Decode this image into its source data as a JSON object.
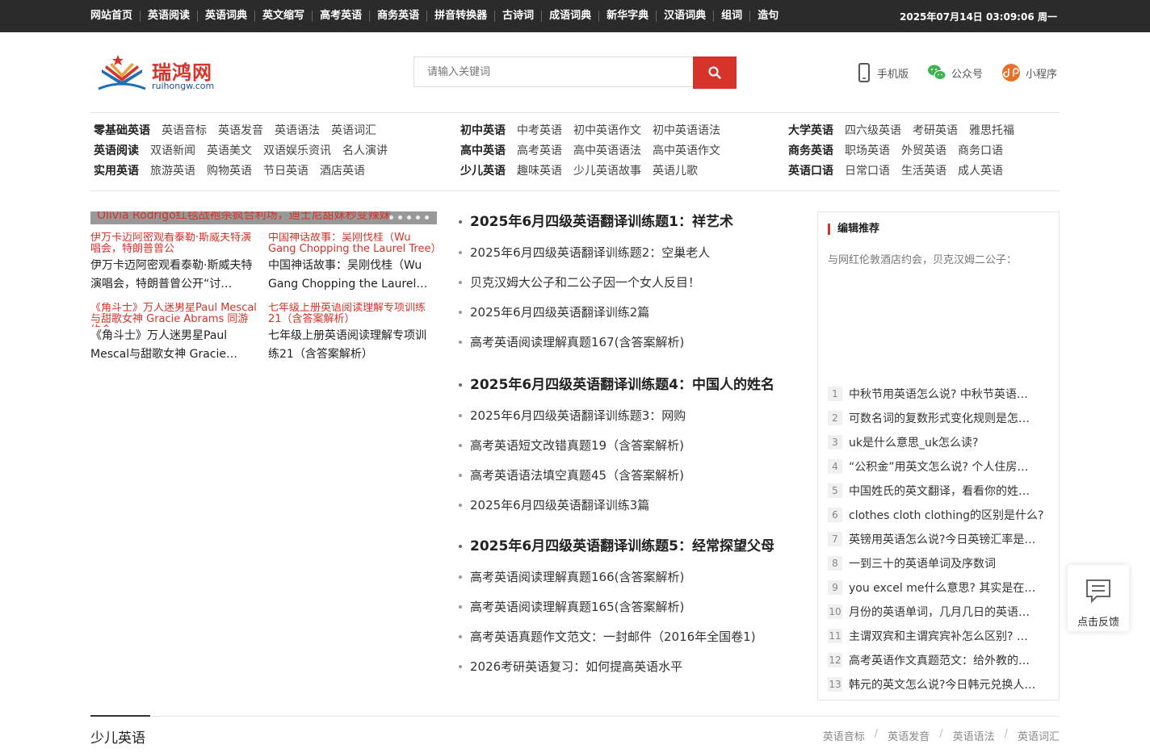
{
  "topnav": {
    "links": [
      "网站首页",
      "英语阅读",
      "英语词典",
      "英文缩写",
      "高考英语",
      "商务英语",
      "拼音转换器",
      "古诗词",
      "成语词典",
      "新华字典",
      "汉语词典",
      "组词",
      "造句"
    ],
    "date": "2025年07月14日 03:09:06",
    "weekday": "周一"
  },
  "logo": {
    "name": "瑞鸿网",
    "domain": "ruihongw.com"
  },
  "search": {
    "placeholder": "请输入关键词",
    "icon": "search-icon"
  },
  "tools": {
    "mobile": "手机版",
    "wechat": "公众号",
    "miniapp": "小程序"
  },
  "categories": [
    {
      "rows": [
        {
          "head": "零基础英语",
          "items": [
            "英语音标",
            "英语发音",
            "英语语法",
            "英语词汇"
          ]
        },
        {
          "head": "英语阅读",
          "items": [
            "双语新闻",
            "英语美文",
            "双语娱乐资讯",
            "名人演讲"
          ]
        },
        {
          "head": "实用英语",
          "items": [
            "旅游英语",
            "购物英语",
            "节日英语",
            "酒店英语"
          ]
        }
      ]
    },
    {
      "rows": [
        {
          "head": "初中英语",
          "items": [
            "中考英语",
            "初中英语作文",
            "初中英语语法"
          ]
        },
        {
          "head": "高中英语",
          "items": [
            "高考英语",
            "高中英语语法",
            "高中英语作文"
          ]
        },
        {
          "head": "少儿英语",
          "items": [
            "趣味英语",
            "少儿英语故事",
            "英语儿歌"
          ]
        }
      ]
    },
    {
      "rows": [
        {
          "head": "大学英语",
          "items": [
            "四六级英语",
            "考研英语",
            "雅思托福"
          ]
        },
        {
          "head": "商务英语",
          "items": [
            "职场英语",
            "外贸英语",
            "商务口语"
          ]
        },
        {
          "head": "英语口语",
          "items": [
            "日常口语",
            "生活英语",
            "成人英语"
          ]
        }
      ]
    }
  ],
  "slider": {
    "caption": "Olivia Rodrigo红毯战袍杀疯合利场，迪士尼甜妹秒变辣妹"
  },
  "thumbs": [
    {
      "alt": "伊万卡迈阿密观看泰勒·斯威夫特演唱会，特朗普曾公",
      "title": "伊万卡迈阿密观看泰勒·斯威夫特演唱会，特朗普曾公开“讨…"
    },
    {
      "alt": "中国神话故事：吴刚伐桂（Wu Gang Chopping the Laurel Tree）",
      "title": "中国神话故事：吴刚伐桂（Wu Gang Chopping the Laurel…"
    },
    {
      "alt": "《角斗士》万人迷男星Paul Mescal与甜歌女神 Gracie Abrams 同游约会",
      "title": "《角斗士》万人迷男星Paul Mescal与甜歌女神 Gracie…"
    },
    {
      "alt": "七年级上册英语阅读理解专项训练21（含答案解析）",
      "title": "七年级上册英语阅读理解专项训练21（含答案解析）"
    }
  ],
  "news": [
    {
      "head": "2025年6月四级英语翻译训练题1：祥艺术",
      "items": [
        "2025年6月四级英语翻译训练题2：空巢老人",
        "贝克汉姆大公子和二公子因一个女人反目！",
        "2025年6月四级英语翻译训练2篇",
        "高考英语阅读理解真题167(含答案解析)"
      ]
    },
    {
      "head": "2025年6月四级英语翻译训练题4：中国人的姓名",
      "items": [
        "2025年6月四级英语翻译训练题3：网购",
        "高考英语短文改错真题19（含答案解析)",
        "高考英语语法填空真题45（含答案解析)",
        "2025年6月四级英语翻译训练3篇"
      ]
    },
    {
      "head": "2025年6月四级英语翻译训练题5：经常探望父母",
      "items": [
        "高考英语阅读理解真题166(含答案解析)",
        "高考英语阅读理解真题165(含答案解析)",
        "高考英语真题作文范文：一封邮件（2016年全国卷1)",
        "2026考研英语复习：如何提高英语水平"
      ]
    }
  ],
  "recommend": {
    "title": "编辑推荐",
    "img_alt": "与网红伦敦酒店约会，贝克汉姆二公子：",
    "rank": [
      {
        "no": "1",
        "text": "中秋节用英语怎么说? 中秋节英语…"
      },
      {
        "no": "2",
        "text": "可数名词的复数形式变化规则是怎…"
      },
      {
        "no": "3",
        "text": "uk是什么意思_uk怎么读?"
      },
      {
        "no": "4",
        "text": "“公积金”用英文怎么说? 个人住房…"
      },
      {
        "no": "5",
        "text": "中国姓氏的英文翻译，看看你的姓…"
      },
      {
        "no": "6",
        "text": "clothes cloth clothing的区别是什么?"
      },
      {
        "no": "7",
        "text": "英镑用英语怎么说?今日英镑汇率是…"
      },
      {
        "no": "8",
        "text": "一到三十的英语单词及序数词"
      },
      {
        "no": "9",
        "text": "you excel me什么意思? 其实是在…"
      },
      {
        "no": "10",
        "text": "月份的英语单词，几月几日的英语…"
      },
      {
        "no": "11",
        "text": "主谓双宾和主谓宾宾补怎么区别? …"
      },
      {
        "no": "12",
        "text": "高考英语作文真题范文：给外教的…"
      },
      {
        "no": "13",
        "text": "韩元的英文怎么说?今日韩元兑换人…"
      }
    ]
  },
  "feedback": {
    "label": "点击反馈"
  },
  "section": {
    "title": "少儿英语",
    "links": [
      "英语音标",
      "英语发音",
      "英语语法",
      "英语词汇"
    ]
  },
  "colors": {
    "accent": "#d6332a",
    "topbar": "#2b2b2b"
  }
}
